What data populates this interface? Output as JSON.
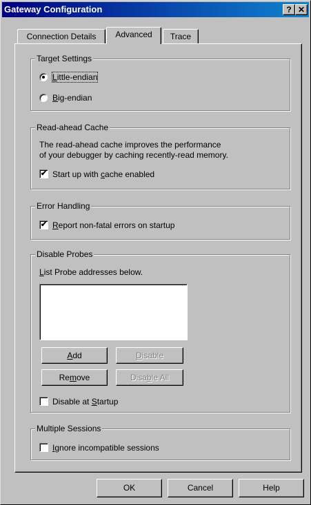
{
  "window": {
    "title": "Gateway Configuration",
    "help_glyph": "?",
    "close_glyph": "✕"
  },
  "tabs": [
    {
      "label": "Connection Details",
      "active": false
    },
    {
      "label": "Advanced",
      "active": true
    },
    {
      "label": "Trace",
      "active": false
    }
  ],
  "target_settings": {
    "legend": "Target Settings",
    "options": [
      {
        "mnemonic": "L",
        "rest": "ittle-endian",
        "selected": true
      },
      {
        "mnemonic": "B",
        "rest": "ig-endian",
        "selected": false
      }
    ]
  },
  "read_ahead": {
    "legend": "Read-ahead Cache",
    "desc_line1": "The read-ahead cache improves the performance",
    "desc_line2": "of your debugger by caching recently-read memory.",
    "checkbox": {
      "pre": "Start up with ",
      "mnemonic": "c",
      "post": "ache enabled",
      "checked": true
    }
  },
  "error_handling": {
    "legend": "Error Handling",
    "checkbox": {
      "pre": "",
      "mnemonic": "R",
      "post": "eport non-fatal errors on startup",
      "checked": true
    }
  },
  "disable_probes": {
    "legend": "Disable Probes",
    "list_label": {
      "mnemonic": "L",
      "rest": "ist Probe addresses below."
    },
    "buttons": {
      "add": {
        "pre": "",
        "mnemonic": "A",
        "post": "dd"
      },
      "disable": {
        "pre": "",
        "mnemonic": "D",
        "post": "isable"
      },
      "remove": {
        "pre": "Re",
        "mnemonic": "m",
        "post": "ove"
      },
      "disable_all": {
        "pre": "Disa",
        "mnemonic": "b",
        "post": "le All"
      }
    },
    "checkbox": {
      "pre": "Disable at ",
      "mnemonic": "S",
      "post": "tartup",
      "checked": false
    }
  },
  "multiple_sessions": {
    "legend": "Multiple Sessions",
    "checkbox": {
      "pre": "",
      "mnemonic": "I",
      "post": "gnore incompatible sessions",
      "checked": false
    }
  },
  "footer": {
    "ok": "OK",
    "cancel": "Cancel",
    "help": "Help"
  },
  "check_glyph": "✔",
  "colors": {
    "title_start": "#000080",
    "title_end": "#1084d0",
    "face": "#c0c0c0"
  }
}
